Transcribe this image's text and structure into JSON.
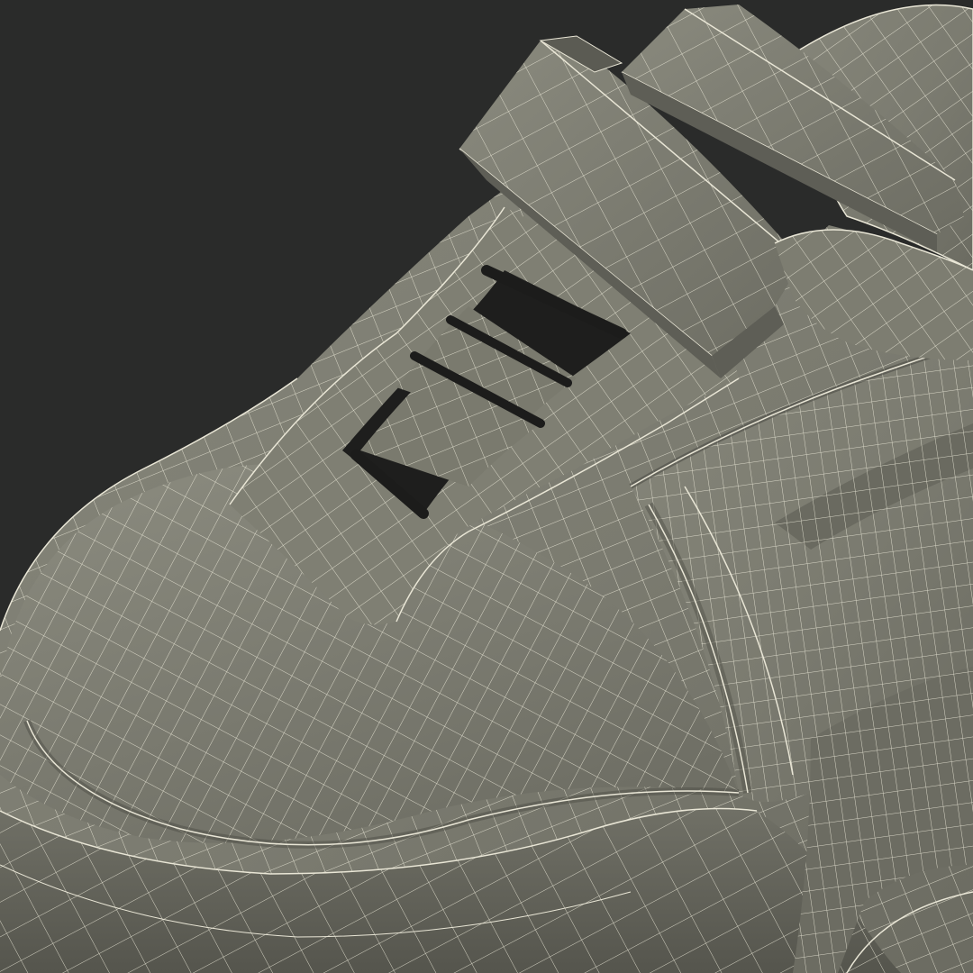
{
  "scene": {
    "background_color": "#2a2b2a",
    "mesh_fill_color": "#7a7a6e",
    "mesh_shadow_color": "#5c5c53",
    "mesh_highlight_color": "#8e8e82",
    "wire_color": "#e9e6d6",
    "cavity_color": "#1c1c1b",
    "subject": "sneaker-wireframe-render"
  }
}
